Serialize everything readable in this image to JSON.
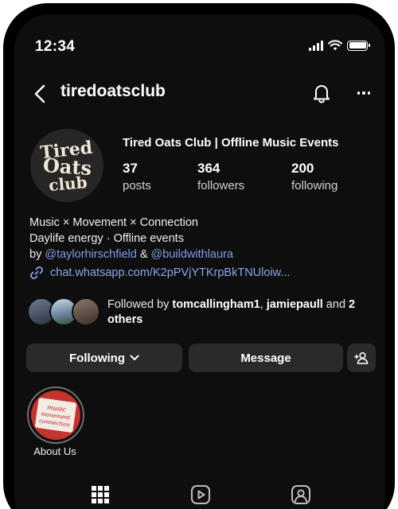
{
  "status_bar": {
    "time": "12:34"
  },
  "header": {
    "username": "tiredoatsclub"
  },
  "profile": {
    "avatar_text": [
      "Tired",
      "Oats",
      "club"
    ],
    "display_name": "Tired Oats Club | Offline Music Events",
    "stats": [
      {
        "value": "37",
        "label": "posts"
      },
      {
        "value": "364",
        "label": "followers"
      },
      {
        "value": "200",
        "label": "following"
      }
    ]
  },
  "bio": {
    "line1": "Music × Movement × Connection",
    "line2": "Daylife energy · Offline events",
    "by_prefix": "by ",
    "mention1": "@taylorhirschfield",
    "amp": " & ",
    "mention2": "@buildwithlaura",
    "link": "chat.whatsapp.com/K2pPVjYTKrpBkTNUloiw..."
  },
  "followed_by": {
    "prefix": "Followed by ",
    "user1": "tomcallingham1",
    "sep": ", ",
    "user2": "jamiepaull",
    "and": " and ",
    "others": "2 others"
  },
  "actions": {
    "following_label": "Following",
    "message_label": "Message"
  },
  "highlights": [
    {
      "label": "About Us",
      "cover_text": [
        "music",
        "movement",
        "connection"
      ]
    }
  ],
  "colors": {
    "background": "#0e0e0e",
    "button": "#2a2a2a",
    "link": "#8aa6ee",
    "highlight_cover": "#c4332d"
  }
}
